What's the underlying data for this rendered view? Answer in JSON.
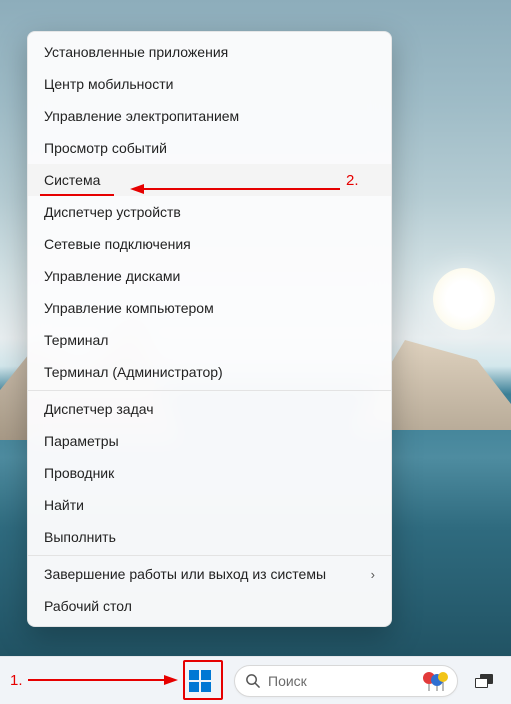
{
  "annotations": {
    "label_1": "1.",
    "label_2": "2."
  },
  "context_menu": {
    "groups": [
      [
        {
          "label": "Установленные приложения",
          "name": "menu-installed-apps"
        },
        {
          "label": "Центр мобильности",
          "name": "menu-mobility-center"
        },
        {
          "label": "Управление электропитанием",
          "name": "menu-power-options"
        },
        {
          "label": "Просмотр событий",
          "name": "menu-event-viewer"
        },
        {
          "label": "Система",
          "name": "menu-system",
          "highlight": true
        },
        {
          "label": "Диспетчер устройств",
          "name": "menu-device-manager"
        },
        {
          "label": "Сетевые подключения",
          "name": "menu-network-connections"
        },
        {
          "label": "Управление дисками",
          "name": "menu-disk-management"
        },
        {
          "label": "Управление компьютером",
          "name": "menu-computer-management"
        },
        {
          "label": "Терминал",
          "name": "menu-terminal"
        },
        {
          "label": "Терминал (Администратор)",
          "name": "menu-terminal-admin"
        }
      ],
      [
        {
          "label": "Диспетчер задач",
          "name": "menu-task-manager"
        },
        {
          "label": "Параметры",
          "name": "menu-settings"
        },
        {
          "label": "Проводник",
          "name": "menu-file-explorer"
        },
        {
          "label": "Найти",
          "name": "menu-search"
        },
        {
          "label": "Выполнить",
          "name": "menu-run"
        }
      ],
      [
        {
          "label": "Завершение работы или выход из системы",
          "name": "menu-shutdown-signout",
          "submenu": true
        },
        {
          "label": "Рабочий стол",
          "name": "menu-desktop"
        }
      ]
    ]
  },
  "taskbar": {
    "search_placeholder": "Поиск"
  }
}
